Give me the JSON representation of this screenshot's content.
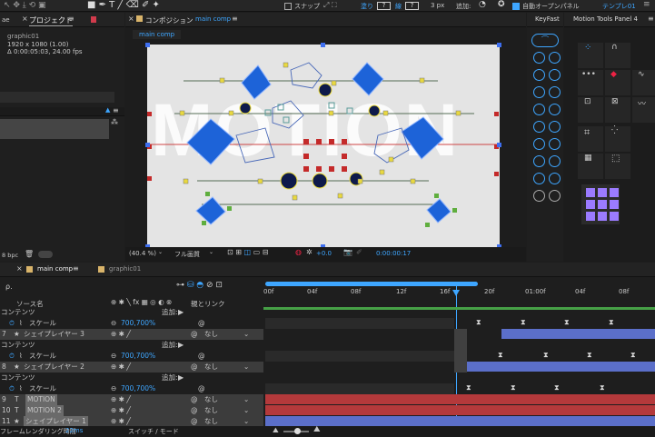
{
  "toolbar": {
    "snap": "スナップ",
    "fill": "塗り",
    "stroke": "線",
    "stroke_width": "3 px",
    "add": "追加:",
    "auto_open": "自動オープンパネル",
    "workspace": "テンプレ01"
  },
  "project_panel": {
    "tab_left": "ae",
    "tab": "プロジェクト",
    "item_name": "graphic01",
    "item_res": "1920 x 1080 (1.00)",
    "item_dur": "Δ 0:00:05:03, 24.00 fps",
    "footer_bpc": "8 bpc"
  },
  "comp_panel": {
    "tab": "コンポジション",
    "tab_name": "main comp",
    "breadcrumb": "main comp",
    "zoom": "(40.4 %)",
    "quality": "フル画質",
    "exposure": "+0.0",
    "timecode": "0:00:00:17",
    "watermark": "MOTION"
  },
  "keyfast": {
    "title": "KeyFast"
  },
  "motion_tools": {
    "title": "Motion Tools Panel 4"
  },
  "timeline": {
    "tab": "main comp",
    "tab2": "graphic01",
    "search_placeholder": "ρ.",
    "col_source": "ソース名",
    "col_parent": "親とリンク",
    "ruler": [
      "00f",
      "04f",
      "08f",
      "12f",
      "16f",
      "20f",
      "01:00f",
      "04f",
      "08f"
    ],
    "rows": [
      {
        "kind": "group",
        "label": "コンテンツ",
        "add": "追加:"
      },
      {
        "kind": "prop",
        "label": "スケール",
        "value": "700,700%"
      },
      {
        "kind": "layer",
        "num": "7",
        "label": "シェイプレイヤー 3",
        "parent": "なし"
      },
      {
        "kind": "group",
        "label": "コンテンツ",
        "add": "追加:"
      },
      {
        "kind": "prop",
        "label": "スケール",
        "value": "700,700%"
      },
      {
        "kind": "layer",
        "num": "8",
        "label": "シェイプレイヤー 2",
        "parent": "なし"
      },
      {
        "kind": "group",
        "label": "コンテンツ",
        "add": "追加:"
      },
      {
        "kind": "prop",
        "label": "スケール",
        "value": "700,700%"
      },
      {
        "kind": "text",
        "num": "9",
        "label": "MOTION",
        "parent": "なし"
      },
      {
        "kind": "text",
        "num": "10",
        "label": "MOTION 2",
        "parent": "なし"
      },
      {
        "kind": "layer",
        "num": "11",
        "label": "シェイプレイヤー 1",
        "parent": "なし"
      }
    ],
    "footer_render": "フレームレンダリング時間",
    "footer_ms": "22ms",
    "footer_mode": "スイッチ / モード"
  },
  "colors": {
    "accent": "#3ea6ff",
    "layer_blue": "#5b6fc9",
    "layer_red": "#b4393b",
    "shape_blue": "#1d63d8",
    "handle_yellow": "#e8d840"
  }
}
